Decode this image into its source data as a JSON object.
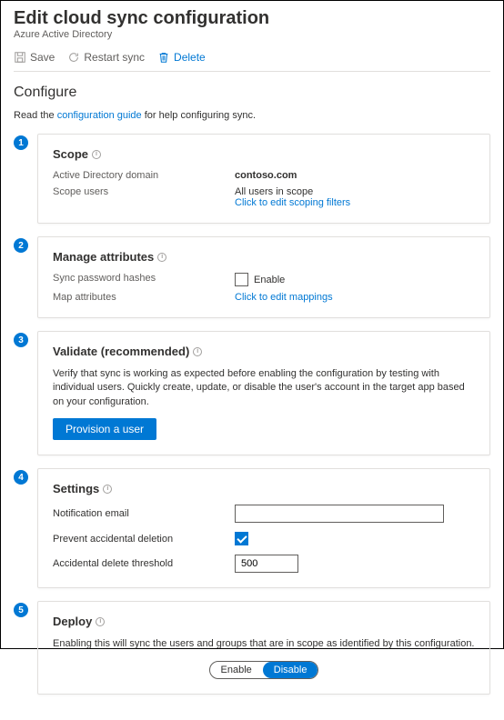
{
  "header": {
    "title": "Edit cloud sync configuration",
    "subtitle": "Azure Active Directory"
  },
  "toolbar": {
    "save": "Save",
    "restart": "Restart sync",
    "delete": "Delete"
  },
  "configure": {
    "heading": "Configure",
    "help_prefix": "Read the ",
    "help_link": "configuration guide",
    "help_suffix": " for help configuring sync."
  },
  "steps": {
    "scope": {
      "num": "1",
      "title": "Scope",
      "domain_label": "Active Directory domain",
      "domain_value": "contoso.com",
      "users_label": "Scope users",
      "users_value": "All users in scope",
      "filters_link": "Click to edit scoping filters"
    },
    "attributes": {
      "num": "2",
      "title": "Manage attributes",
      "hash_label": "Sync password hashes",
      "hash_checkbox_label": "Enable",
      "map_label": "Map attributes",
      "map_link": "Click to edit mappings"
    },
    "validate": {
      "num": "3",
      "title": "Validate (recommended)",
      "desc": "Verify that sync is working as expected before enabling the configuration by testing with individual users. Quickly create, update, or disable the user's account in the target app based on your configuration.",
      "button": "Provision a user"
    },
    "settings": {
      "num": "4",
      "title": "Settings",
      "email_label": "Notification email",
      "email_value": "",
      "prevent_label": "Prevent accidental deletion",
      "prevent_checked": true,
      "threshold_label": "Accidental delete threshold",
      "threshold_value": "500"
    },
    "deploy": {
      "num": "5",
      "title": "Deploy",
      "desc": "Enabling this will sync the users and groups that are in scope as identified by this configuration.",
      "enable": "Enable",
      "disable": "Disable"
    }
  }
}
